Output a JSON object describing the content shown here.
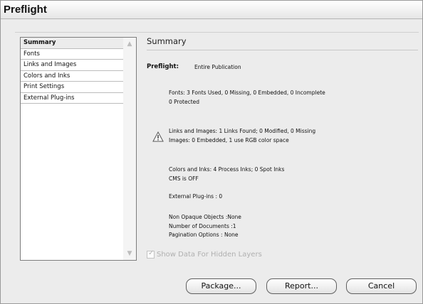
{
  "window": {
    "title": "Preflight"
  },
  "sidebar": {
    "items": [
      {
        "label": "Summary",
        "selected": true
      },
      {
        "label": "Fonts",
        "selected": false
      },
      {
        "label": "Links and Images",
        "selected": false
      },
      {
        "label": "Colors and Inks",
        "selected": false
      },
      {
        "label": "Print Settings",
        "selected": false
      },
      {
        "label": "External Plug-ins",
        "selected": false
      }
    ]
  },
  "main": {
    "heading": "Summary",
    "preflight_label": "Preflight:",
    "preflight_value": "Entire Publication",
    "fonts_line1": "Fonts: 3 Fonts Used, 0 Missing, 0 Embedded, 0 Incomplete",
    "fonts_line2": "0 Protected",
    "links_line1": "Links and Images: 1 Links Found; 0 Modified, 0 Missing",
    "links_line2": "Images: 0 Embedded, 1 use RGB color space",
    "colors_line1": "Colors and Inks: 4 Process Inks; 0 Spot Inks",
    "colors_line2": "CMS is OFF",
    "plugins_line": "External Plug-ins : 0",
    "opaque_line": "Non Opaque Objects :None",
    "docs_line": "Number of Documents :1",
    "pagination_line": "Pagination Options : None",
    "show_hidden_label": "Show Data For Hidden Layers",
    "show_hidden_checked": true,
    "warning_icon": "warning-icon"
  },
  "buttons": {
    "package": "Package...",
    "report": "Report...",
    "cancel": "Cancel"
  }
}
